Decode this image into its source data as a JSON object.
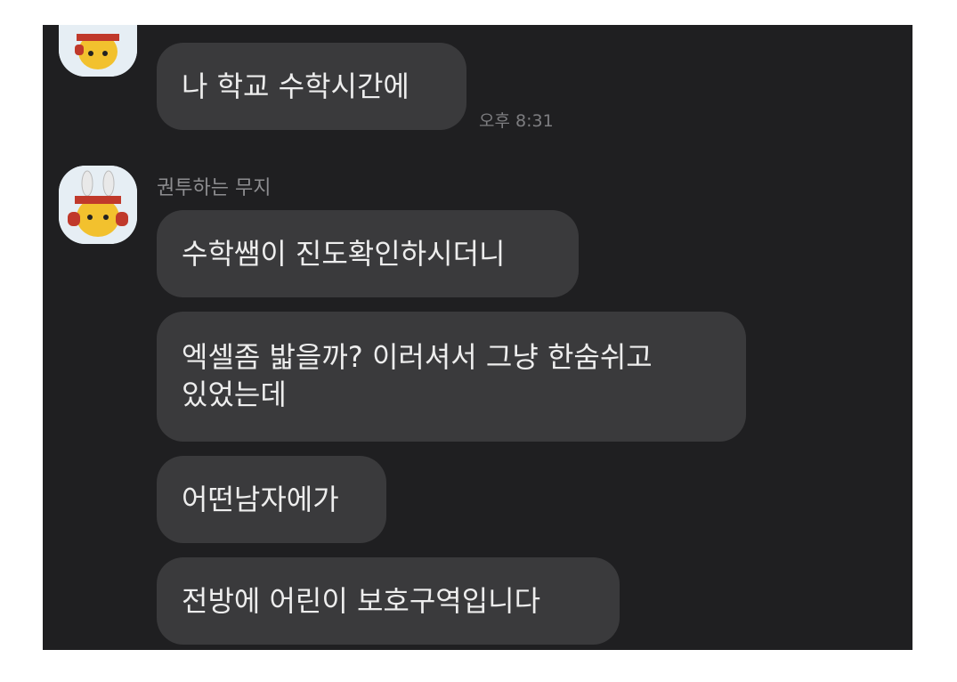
{
  "chat": {
    "sender_name": "권투하는 무지",
    "messages": [
      {
        "text": "나 학교 수학시간에",
        "time": "오후 8:31"
      },
      {
        "text": "수학쌤이 진도확인하시더니"
      },
      {
        "lines": [
          "엑셀좀 밟을까? 이러셔서 그냥 한숨쉬고",
          "있었는데"
        ]
      },
      {
        "text": "어떤남자에가"
      },
      {
        "text": "전방에 어린이 보호구역입니다"
      }
    ]
  },
  "colors": {
    "background": "#1f1f21",
    "bubble": "#3a3a3c",
    "text": "#ededed",
    "meta_text": "#8d8d90"
  },
  "icons": [
    "muzi-boxing-avatar"
  ]
}
